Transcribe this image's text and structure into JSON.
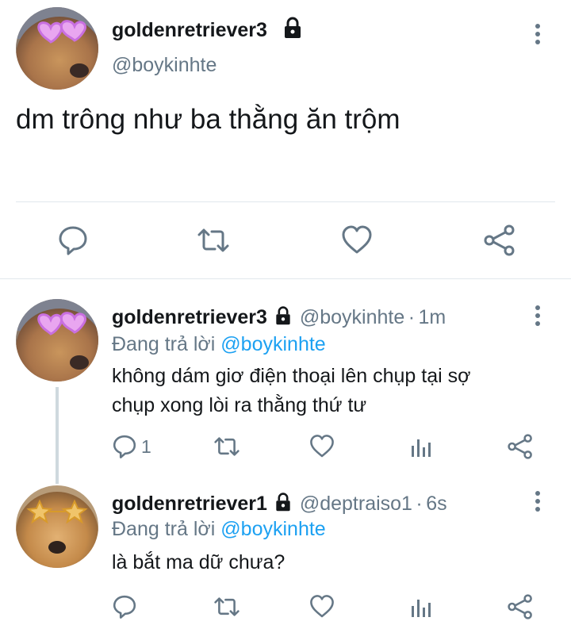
{
  "main_tweet": {
    "display_name": "goldenretriever3",
    "handle": "@boykinhte",
    "text": "dm trông như ba thằng ăn trộm"
  },
  "replies": [
    {
      "display_name": "goldenretriever3",
      "handle": "@boykinhte",
      "separator": "·",
      "time": "1m",
      "replying_prefix": "Đang trả lời",
      "replying_to": "@boykinhte",
      "text_lines": [
        "không dám giơ điện thoại lên chụp tại sợ",
        "chụp xong lòi ra thằng thứ tư"
      ],
      "reply_count": "1"
    },
    {
      "display_name": "goldenretriever1",
      "handle": "@deptraiso1",
      "separator": "·",
      "time": "6s",
      "replying_prefix": "Đang trả lời",
      "replying_to": "@boykinhte",
      "text_lines": [
        "là bắt ma dữ chưa?"
      ],
      "reply_count": ""
    }
  ],
  "icons": {
    "lock": "lock-icon",
    "more": "more-vertical-icon",
    "reply": "reply-icon",
    "retweet": "retweet-icon",
    "like": "heart-icon",
    "share": "share-icon",
    "analytics": "analytics-icon"
  },
  "colors": {
    "text": "#14171a",
    "secondary": "#657786",
    "link": "#1da1f2",
    "divider": "#e1e8ed",
    "icon": "#657786"
  }
}
